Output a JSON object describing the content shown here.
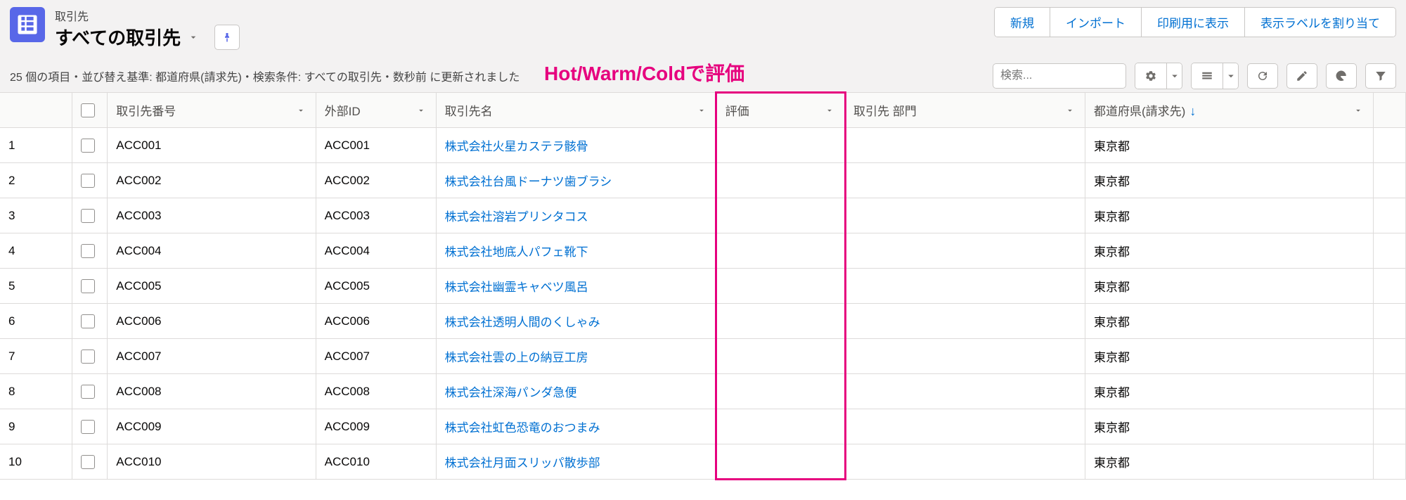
{
  "header": {
    "object_type": "取引先",
    "list_name": "すべての取引先"
  },
  "top_buttons": [
    "新規",
    "インポート",
    "印刷用に表示",
    "表示ラベルを割り当て"
  ],
  "status_text": "25 個の項目・並び替え基準: 都道府県(請求先)・検索条件: すべての取引先・数秒前 に更新されました",
  "annotation": "Hot/Warm/Coldで評価",
  "search": {
    "placeholder": "検索..."
  },
  "columns": {
    "acc_num": "取引先番号",
    "ext_id": "外部ID",
    "acc_name": "取引先名",
    "rating": "評価",
    "dept": "取引先 部門",
    "pref": "都道府県(請求先)"
  },
  "rows": [
    {
      "n": "1",
      "acc_num": "ACC001",
      "ext": "ACC001",
      "name": "株式会社火星カステラ骸骨",
      "rating": "",
      "dept": "",
      "pref": "東京都"
    },
    {
      "n": "2",
      "acc_num": "ACC002",
      "ext": "ACC002",
      "name": "株式会社台風ドーナツ歯ブラシ",
      "rating": "",
      "dept": "",
      "pref": "東京都"
    },
    {
      "n": "3",
      "acc_num": "ACC003",
      "ext": "ACC003",
      "name": "株式会社溶岩プリンタコス",
      "rating": "",
      "dept": "",
      "pref": "東京都"
    },
    {
      "n": "4",
      "acc_num": "ACC004",
      "ext": "ACC004",
      "name": "株式会社地底人パフェ靴下",
      "rating": "",
      "dept": "",
      "pref": "東京都"
    },
    {
      "n": "5",
      "acc_num": "ACC005",
      "ext": "ACC005",
      "name": "株式会社幽霊キャベツ風呂",
      "rating": "",
      "dept": "",
      "pref": "東京都"
    },
    {
      "n": "6",
      "acc_num": "ACC006",
      "ext": "ACC006",
      "name": "株式会社透明人間のくしゃみ",
      "rating": "",
      "dept": "",
      "pref": "東京都"
    },
    {
      "n": "7",
      "acc_num": "ACC007",
      "ext": "ACC007",
      "name": "株式会社雲の上の納豆工房",
      "rating": "",
      "dept": "",
      "pref": "東京都"
    },
    {
      "n": "8",
      "acc_num": "ACC008",
      "ext": "ACC008",
      "name": "株式会社深海パンダ急便",
      "rating": "",
      "dept": "",
      "pref": "東京都"
    },
    {
      "n": "9",
      "acc_num": "ACC009",
      "ext": "ACC009",
      "name": "株式会社虹色恐竜のおつまみ",
      "rating": "",
      "dept": "",
      "pref": "東京都"
    },
    {
      "n": "10",
      "acc_num": "ACC010",
      "ext": "ACC010",
      "name": "株式会社月面スリッパ散歩部",
      "rating": "",
      "dept": "",
      "pref": "東京都"
    }
  ]
}
